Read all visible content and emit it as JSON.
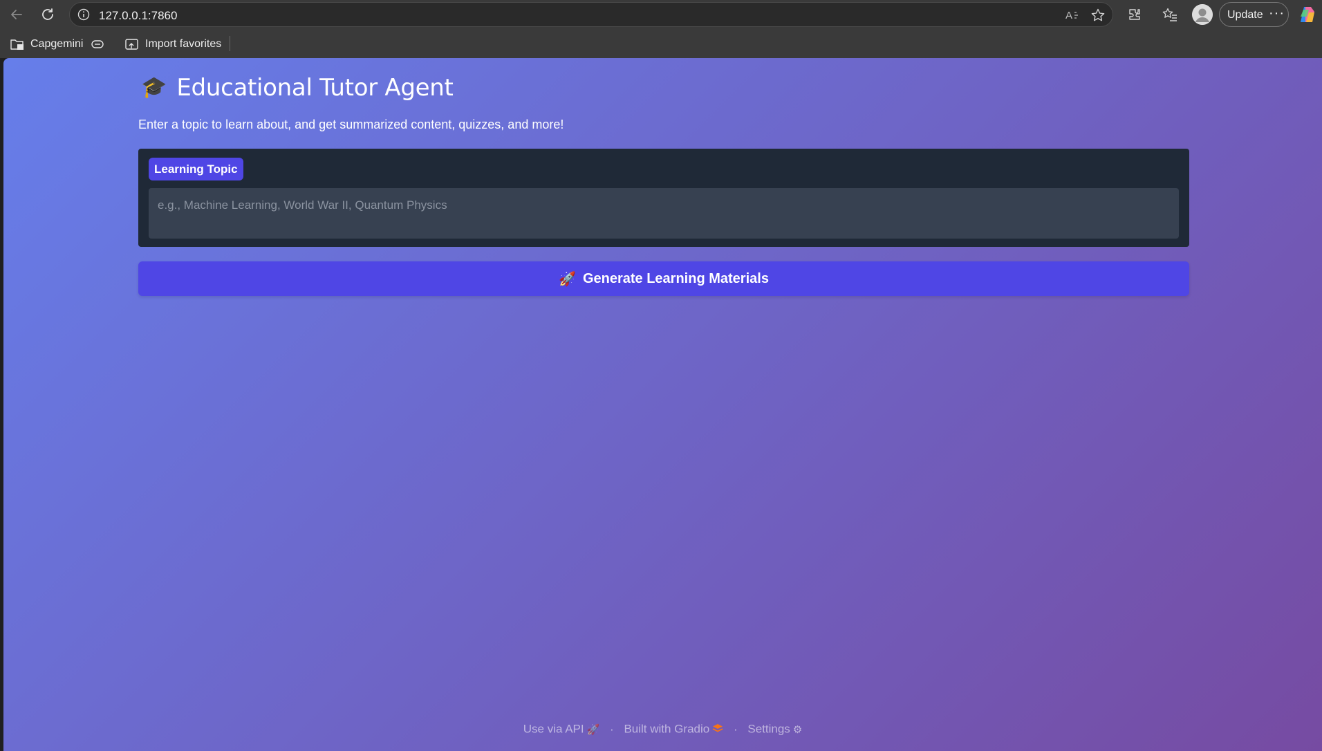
{
  "browser": {
    "url": "127.0.0.1:7860",
    "update_label": "Update",
    "more_label": "···",
    "bookmarks": [
      {
        "label": "Capgemini",
        "icon": "folder-icon"
      },
      {
        "label": "",
        "icon": "collections-icon"
      },
      {
        "label": "Import favorites",
        "icon": "import-icon"
      }
    ]
  },
  "app": {
    "title_icon": "🎓",
    "title": "Educational Tutor Agent",
    "subtitle": "Enter a topic to learn about, and get summarized content, quizzes, and more!",
    "topic": {
      "label": "Learning Topic",
      "value": "",
      "placeholder": "e.g., Machine Learning, World War II, Quantum Physics"
    },
    "generate_button": {
      "icon": "🚀",
      "label": "Generate Learning Materials"
    },
    "colors": {
      "gradient_start": "#667eea",
      "gradient_end": "#764ba2",
      "accent": "#4f46e5",
      "card": "#1f2937",
      "input": "#374151"
    }
  },
  "footer": {
    "api_label": "Use via API",
    "api_icon": "🚀",
    "separator": "·",
    "gradio_label": "Built with Gradio",
    "gradio_icon": "🟧",
    "settings_label": "Settings",
    "settings_icon": "⚙"
  }
}
